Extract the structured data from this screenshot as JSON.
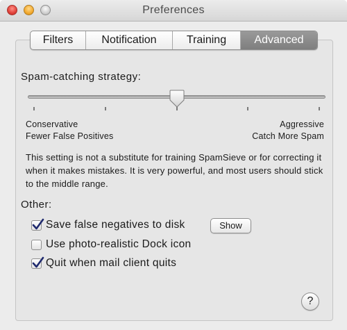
{
  "window": {
    "title": "Preferences"
  },
  "tabs": [
    {
      "label": "Filters",
      "active": false
    },
    {
      "label": "Notification",
      "active": false
    },
    {
      "label": "Training",
      "active": false
    },
    {
      "label": "Advanced",
      "active": true
    }
  ],
  "strategy": {
    "label": "Spam-catching strategy:",
    "slider_value": 0.5,
    "tick_count": 5,
    "left_label_line1": "Conservative",
    "left_label_line2": "Fewer False Positives",
    "right_label_line1": "Aggressive",
    "right_label_line2": "Catch More Spam",
    "note": "This setting is not a substitute for training SpamSieve or for correcting it when it makes mistakes. It is very powerful, and most users should stick to the middle range."
  },
  "other": {
    "label": "Other:",
    "options": [
      {
        "label": "Save false negatives to disk",
        "checked": true
      },
      {
        "label": "Use photo-realistic Dock icon",
        "checked": false
      },
      {
        "label": "Quit when mail client quits",
        "checked": true
      }
    ],
    "show_button": "Show"
  },
  "help": {
    "label": "?"
  },
  "colors": {
    "window_bg": "#ececec",
    "active_tab": "#8a8a8a",
    "checkmark": "#1f2a6e"
  },
  "icons": {
    "close": "close-traffic-light-icon",
    "minimize": "minimize-traffic-light-icon",
    "zoom": "zoom-traffic-light-icon",
    "slider_thumb": "slider-thumb-icon",
    "check": "checkmark-icon",
    "help": "question-mark-icon"
  }
}
